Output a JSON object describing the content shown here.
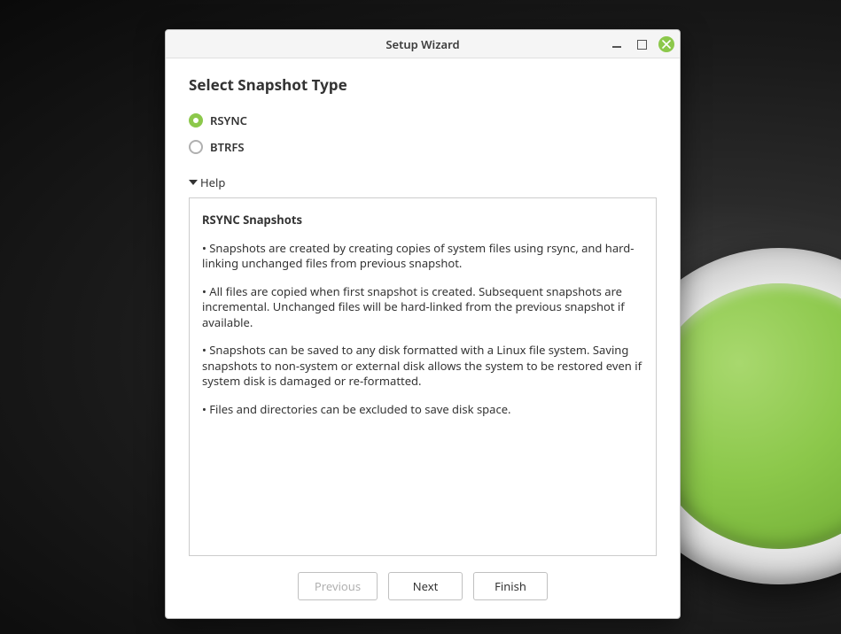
{
  "window": {
    "title": "Setup Wizard"
  },
  "page": {
    "title": "Select Snapshot Type"
  },
  "options": {
    "rsync": {
      "label": "RSYNC",
      "selected": true
    },
    "btrfs": {
      "label": "BTRFS",
      "selected": false
    }
  },
  "expander": {
    "label": "Help",
    "expanded": true
  },
  "help": {
    "heading": "RSYNC Snapshots",
    "bullets": [
      "• Snapshots are created by creating copies of system files using rsync, and hard-linking unchanged files from previous snapshot.",
      "• All files are copied when first snapshot is created. Subsequent snapshots are incremental. Unchanged files will be hard-linked from the previous snapshot if available.",
      "• Snapshots can be saved to any disk formatted with a Linux file system. Saving snapshots to non-system or external disk allows the system to be restored even if system disk is damaged or re-formatted.",
      "• Files and directories can be excluded to save disk space."
    ]
  },
  "buttons": {
    "previous": {
      "label": "Previous",
      "enabled": false
    },
    "next": {
      "label": "Next",
      "enabled": true
    },
    "finish": {
      "label": "Finish",
      "enabled": true
    }
  },
  "colors": {
    "accent": "#8cc84b"
  }
}
